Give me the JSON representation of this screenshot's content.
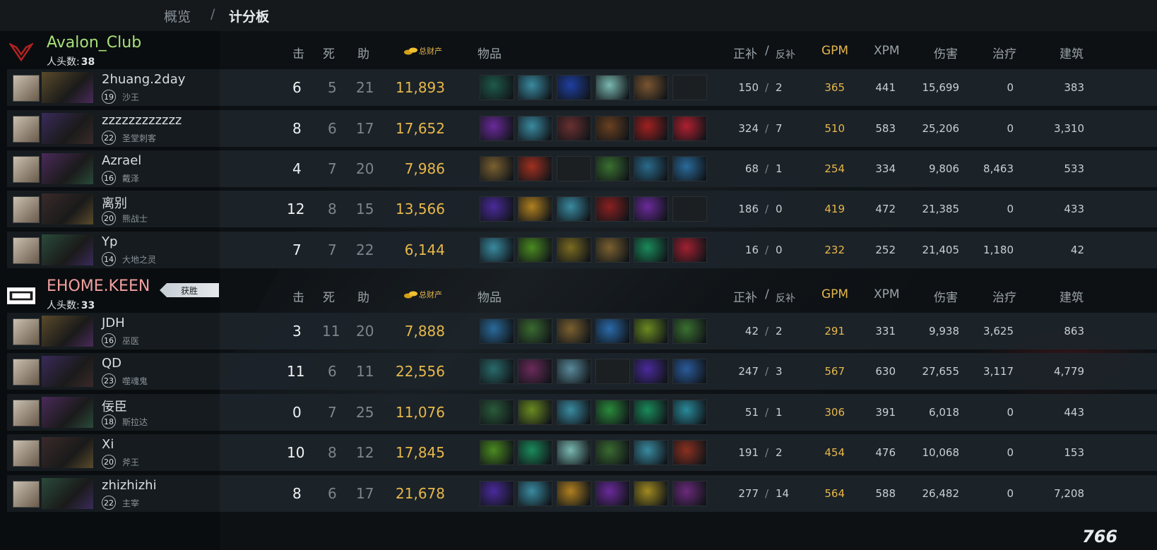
{
  "breadcrumb": {
    "overview": "概览",
    "sep": "/",
    "current": "计分板"
  },
  "columns": {
    "kills": "击",
    "deaths": "死",
    "assists": "助",
    "networth": "总财产",
    "items": "物品",
    "last_hits": "正补",
    "slash": "/",
    "denies": "反补",
    "gpm": "GPM",
    "xpm": "XPM",
    "damage": "伤害",
    "healing": "治疗",
    "tower": "建筑"
  },
  "kills_label": "人头数:",
  "teams": [
    {
      "name": "Avalon_Club",
      "kills": "38",
      "win_badge": "",
      "players": [
        {
          "name": "2huang.2day",
          "level": "19",
          "hero": "沙王",
          "k": "6",
          "d": "5",
          "a": "21",
          "nw": "11,893",
          "lh": "150",
          "dn": "2",
          "gpm": "365",
          "xpm": "441",
          "dmg": "15,699",
          "heal": "0",
          "tower": "383",
          "items": [
            "#1f5a4a",
            "#3a8aa0",
            "#1e3fa0",
            "#7ab8b0",
            "#7a5530",
            "empty"
          ]
        },
        {
          "name": "zzzzzzzzzzzz",
          "level": "22",
          "hero": "圣堂刺客",
          "k": "8",
          "d": "6",
          "a": "17",
          "nw": "17,652",
          "lh": "324",
          "dn": "7",
          "gpm": "510",
          "xpm": "583",
          "dmg": "25,206",
          "heal": "0",
          "tower": "3,310",
          "items": [
            "#6a2a9a",
            "#3a8aa0",
            "#6a3030",
            "#6a4020",
            "#a02020",
            "#b02030"
          ]
        },
        {
          "name": "Azrael",
          "level": "16",
          "hero": "戴泽",
          "k": "4",
          "d": "7",
          "a": "20",
          "nw": "7,986",
          "lh": "68",
          "dn": "1",
          "gpm": "254",
          "xpm": "334",
          "dmg": "9,806",
          "heal": "8,463",
          "tower": "533",
          "items": [
            "#7a6030",
            "#a03020",
            "empty",
            "#3a7030",
            "#2a6a8a",
            "#2a6a9a"
          ]
        },
        {
          "name": "离别",
          "level": "20",
          "hero": "熊战士",
          "k": "12",
          "d": "8",
          "a": "15",
          "nw": "13,566",
          "lh": "186",
          "dn": "0",
          "gpm": "419",
          "xpm": "472",
          "dmg": "21,385",
          "heal": "0",
          "tower": "433",
          "items": [
            "#4a2a9a",
            "#b08020",
            "#3a8aa0",
            "#8a2020",
            "#6a2a9a",
            "empty"
          ]
        },
        {
          "name": "Yp",
          "level": "14",
          "hero": "大地之灵",
          "k": "7",
          "d": "7",
          "a": "22",
          "nw": "6,144",
          "lh": "16",
          "dn": "0",
          "gpm": "232",
          "xpm": "252",
          "dmg": "21,405",
          "heal": "1,180",
          "tower": "42",
          "items": [
            "#3a8aa0",
            "#4a8a20",
            "#7a6a20",
            "#7a6030",
            "#1a8a5a",
            "#a02030"
          ]
        }
      ]
    },
    {
      "name": "EHOME.KEEN",
      "kills": "33",
      "win_badge": "获胜",
      "players": [
        {
          "name": "JDH",
          "level": "16",
          "hero": "巫医",
          "k": "3",
          "d": "11",
          "a": "20",
          "nw": "7,888",
          "lh": "42",
          "dn": "2",
          "gpm": "291",
          "xpm": "331",
          "dmg": "9,938",
          "heal": "3,625",
          "tower": "863",
          "items": [
            "#2a6a9a",
            "#3a6a30",
            "#7a6030",
            "#2a6aaa",
            "#6a8a20",
            "#3a7030"
          ]
        },
        {
          "name": "QD",
          "level": "23",
          "hero": "噬魂鬼",
          "k": "11",
          "d": "6",
          "a": "11",
          "nw": "22,556",
          "lh": "247",
          "dn": "3",
          "gpm": "567",
          "xpm": "630",
          "dmg": "27,655",
          "heal": "3,117",
          "tower": "4,779",
          "items": [
            "#2a6a6a",
            "#6a2a5a",
            "#5a8a9a",
            "empty",
            "#4a2a9a",
            "#2a5a9a"
          ]
        },
        {
          "name": "佞臣",
          "level": "18",
          "hero": "斯拉达",
          "k": "0",
          "d": "7",
          "a": "25",
          "nw": "11,076",
          "lh": "51",
          "dn": "1",
          "gpm": "306",
          "xpm": "391",
          "dmg": "6,018",
          "heal": "0",
          "tower": "443",
          "items": [
            "#2a5a3a",
            "#6a8a20",
            "#3a8aa0",
            "#2a8a3a",
            "#1a8a5a",
            "#2a8a9a"
          ]
        },
        {
          "name": "Xi",
          "level": "20",
          "hero": "斧王",
          "k": "10",
          "d": "8",
          "a": "12",
          "nw": "17,845",
          "lh": "191",
          "dn": "2",
          "gpm": "454",
          "xpm": "476",
          "dmg": "10,068",
          "heal": "0",
          "tower": "153",
          "items": [
            "#4a8a20",
            "#1a8a5a",
            "#7ab8b0",
            "#3a6a30",
            "#3a8aa0",
            "#8a3020"
          ]
        },
        {
          "name": "zhizhizhi",
          "level": "22",
          "hero": "主宰",
          "k": "8",
          "d": "6",
          "a": "17",
          "nw": "21,678",
          "lh": "277",
          "dn": "14",
          "gpm": "564",
          "xpm": "588",
          "dmg": "26,482",
          "heal": "0",
          "tower": "7,208",
          "items": [
            "#4a2a9a",
            "#3a8aa0",
            "#b08020",
            "#6a2a9a",
            "#a08a20",
            "#6a2a7a"
          ]
        }
      ]
    }
  ],
  "watermark": "766"
}
